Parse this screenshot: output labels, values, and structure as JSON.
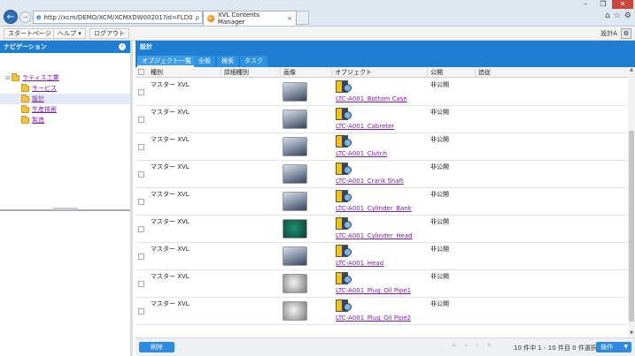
{
  "browser": {
    "url": "http://xcm/DEMO/XCM/XCMXDW00201?id=FLD0",
    "url_controls": "ρ ▾ C",
    "tab_title": "XVL Contents Manager",
    "tab_close": "×"
  },
  "toolbar": {
    "start_page": "スタートページ",
    "help": "ヘルプ",
    "help_caret": "▾",
    "logout": "ログアウト",
    "user": "設計A"
  },
  "nav": {
    "title": "ナビゲーション",
    "tree": [
      {
        "label": "ラティス工業",
        "level": 0
      },
      {
        "label": "サービス",
        "level": 1
      },
      {
        "label": "設計",
        "level": 1
      },
      {
        "label": "生産技術",
        "level": 1
      },
      {
        "label": "製造",
        "level": 1
      }
    ]
  },
  "main": {
    "title": "設計",
    "tabs": [
      "オブジェクト一覧",
      "全般",
      "検索",
      "タスク"
    ],
    "columns": {
      "type": "種別",
      "detail": "詳細種別",
      "image": "画像",
      "object": "オブジェクト",
      "public": "公開",
      "tracking": "追従"
    },
    "rows": [
      {
        "type": "マスター XVL",
        "object": "LTC-A001_Bottom Case",
        "public": "非公開"
      },
      {
        "type": "マスター XVL",
        "object": "LTC-A001_Cabreter",
        "public": "非公開"
      },
      {
        "type": "マスター XVL",
        "object": "LTC-A001_Clutch",
        "public": "非公開"
      },
      {
        "type": "マスター XVL",
        "object": "LTC-A001_Crank Shaft",
        "public": "非公開"
      },
      {
        "type": "マスター XVL",
        "object": "LTC-A001_Cylinder_Bank",
        "public": "非公開"
      },
      {
        "type": "マスター XVL",
        "object": "LTC-A001_Cylinder_Head",
        "public": "非公開"
      },
      {
        "type": "マスター XVL",
        "object": "LTC-A001_Head",
        "public": "非公開"
      },
      {
        "type": "マスター XVL",
        "object": "LTC-A001_Plug_Oil Pipe1",
        "public": "非公開"
      },
      {
        "type": "マスター XVL",
        "object": "LTC-A001_Plug_Oil Pipe2",
        "public": "非公開"
      }
    ],
    "delete_label": "削除",
    "pager_info": "10 件中 1 - 10 件目 0 件選択中",
    "operation_label": "操作"
  }
}
